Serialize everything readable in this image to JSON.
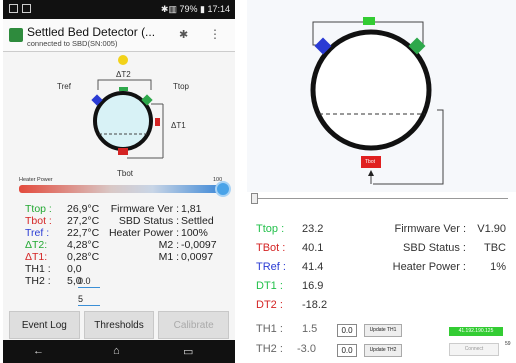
{
  "left": {
    "status": {
      "battery": "79%",
      "time": "17:14"
    },
    "app": {
      "title": "Settled Bed Detector (...",
      "subtitle": "connected to SBD(SN:005)"
    },
    "diagram": {
      "dt2": "ΔT2",
      "tref": "Tref",
      "ttop": "Ttop",
      "dt1": "ΔT1",
      "tbot": "Tbot"
    },
    "heater": {
      "label": "Heater Power",
      "max": "100",
      "level_percent": 100
    },
    "readouts": [
      {
        "k": "Ttop :",
        "v": "26,9°C",
        "k2": "Firmware Ver :",
        "v2": "1,81",
        "color": "#22a832"
      },
      {
        "k": "Tbot :",
        "v": "27,2°C",
        "k2": "SBD Status :",
        "v2": "Settled",
        "color": "#d42424"
      },
      {
        "k": "Tref :",
        "v": "22,7°C",
        "k2": "Heater Power :",
        "v2": "100%",
        "color": "#2a3bd4"
      },
      {
        "k": "ΔT2:",
        "v": "4,28°C",
        "k2": "M2 :",
        "v2": "-0,0097",
        "color": "#22a832"
      },
      {
        "k": "ΔT1:",
        "v": "0,28°C",
        "k2": "M1 :",
        "v2": "0,0097",
        "color": "#d42424"
      },
      {
        "k": "TH1 :",
        "v": "0,0",
        "k2": "",
        "v2": "",
        "color": "#222"
      },
      {
        "k": "TH2 :",
        "v": "5,0",
        "k2": "",
        "v2": "",
        "color": "#222"
      }
    ],
    "th1_input": "0.0",
    "th2_input": "5",
    "buttons": {
      "event_log": "Event Log",
      "thresholds": "Thresholds",
      "calibrate": "Calibrate"
    },
    "nav": {
      "back": "←",
      "home": "⌂",
      "recent": "▭"
    }
  },
  "right": {
    "diagram": {
      "tbot": "Tbot"
    },
    "values": [
      {
        "k": "Ttop :",
        "v": "23.2",
        "color": "#22c04a"
      },
      {
        "k": "TBot :",
        "v": "40.1",
        "color": "#d42424"
      },
      {
        "k": "TRef :",
        "v": "41.4",
        "color": "#2a3bd4"
      },
      {
        "k": "DT1 :",
        "v": "16.9",
        "color": "#22c04a"
      },
      {
        "k": "DT2 :",
        "v": "-18.2",
        "color": "#d42424"
      }
    ],
    "status": [
      {
        "k": "Firmware Ver :",
        "v": "V1.90"
      },
      {
        "k": "SBD Status :",
        "v": "TBC"
      },
      {
        "k": "Heater Power :",
        "v": "1%"
      }
    ],
    "th1": {
      "label": "TH1 :",
      "value": "1.5",
      "input": "0.0",
      "button": "Update TH1"
    },
    "th2": {
      "label": "TH2 :",
      "value": "-3.0",
      "input": "0.0",
      "button": "Update TH2"
    },
    "ip": "41.192.190.125",
    "connect": "Connect",
    "conn_num": "59"
  },
  "colors": {
    "green": "#22a832",
    "red": "#d42424",
    "blue": "#2a3bd4",
    "accent": "#3b8fd6"
  }
}
